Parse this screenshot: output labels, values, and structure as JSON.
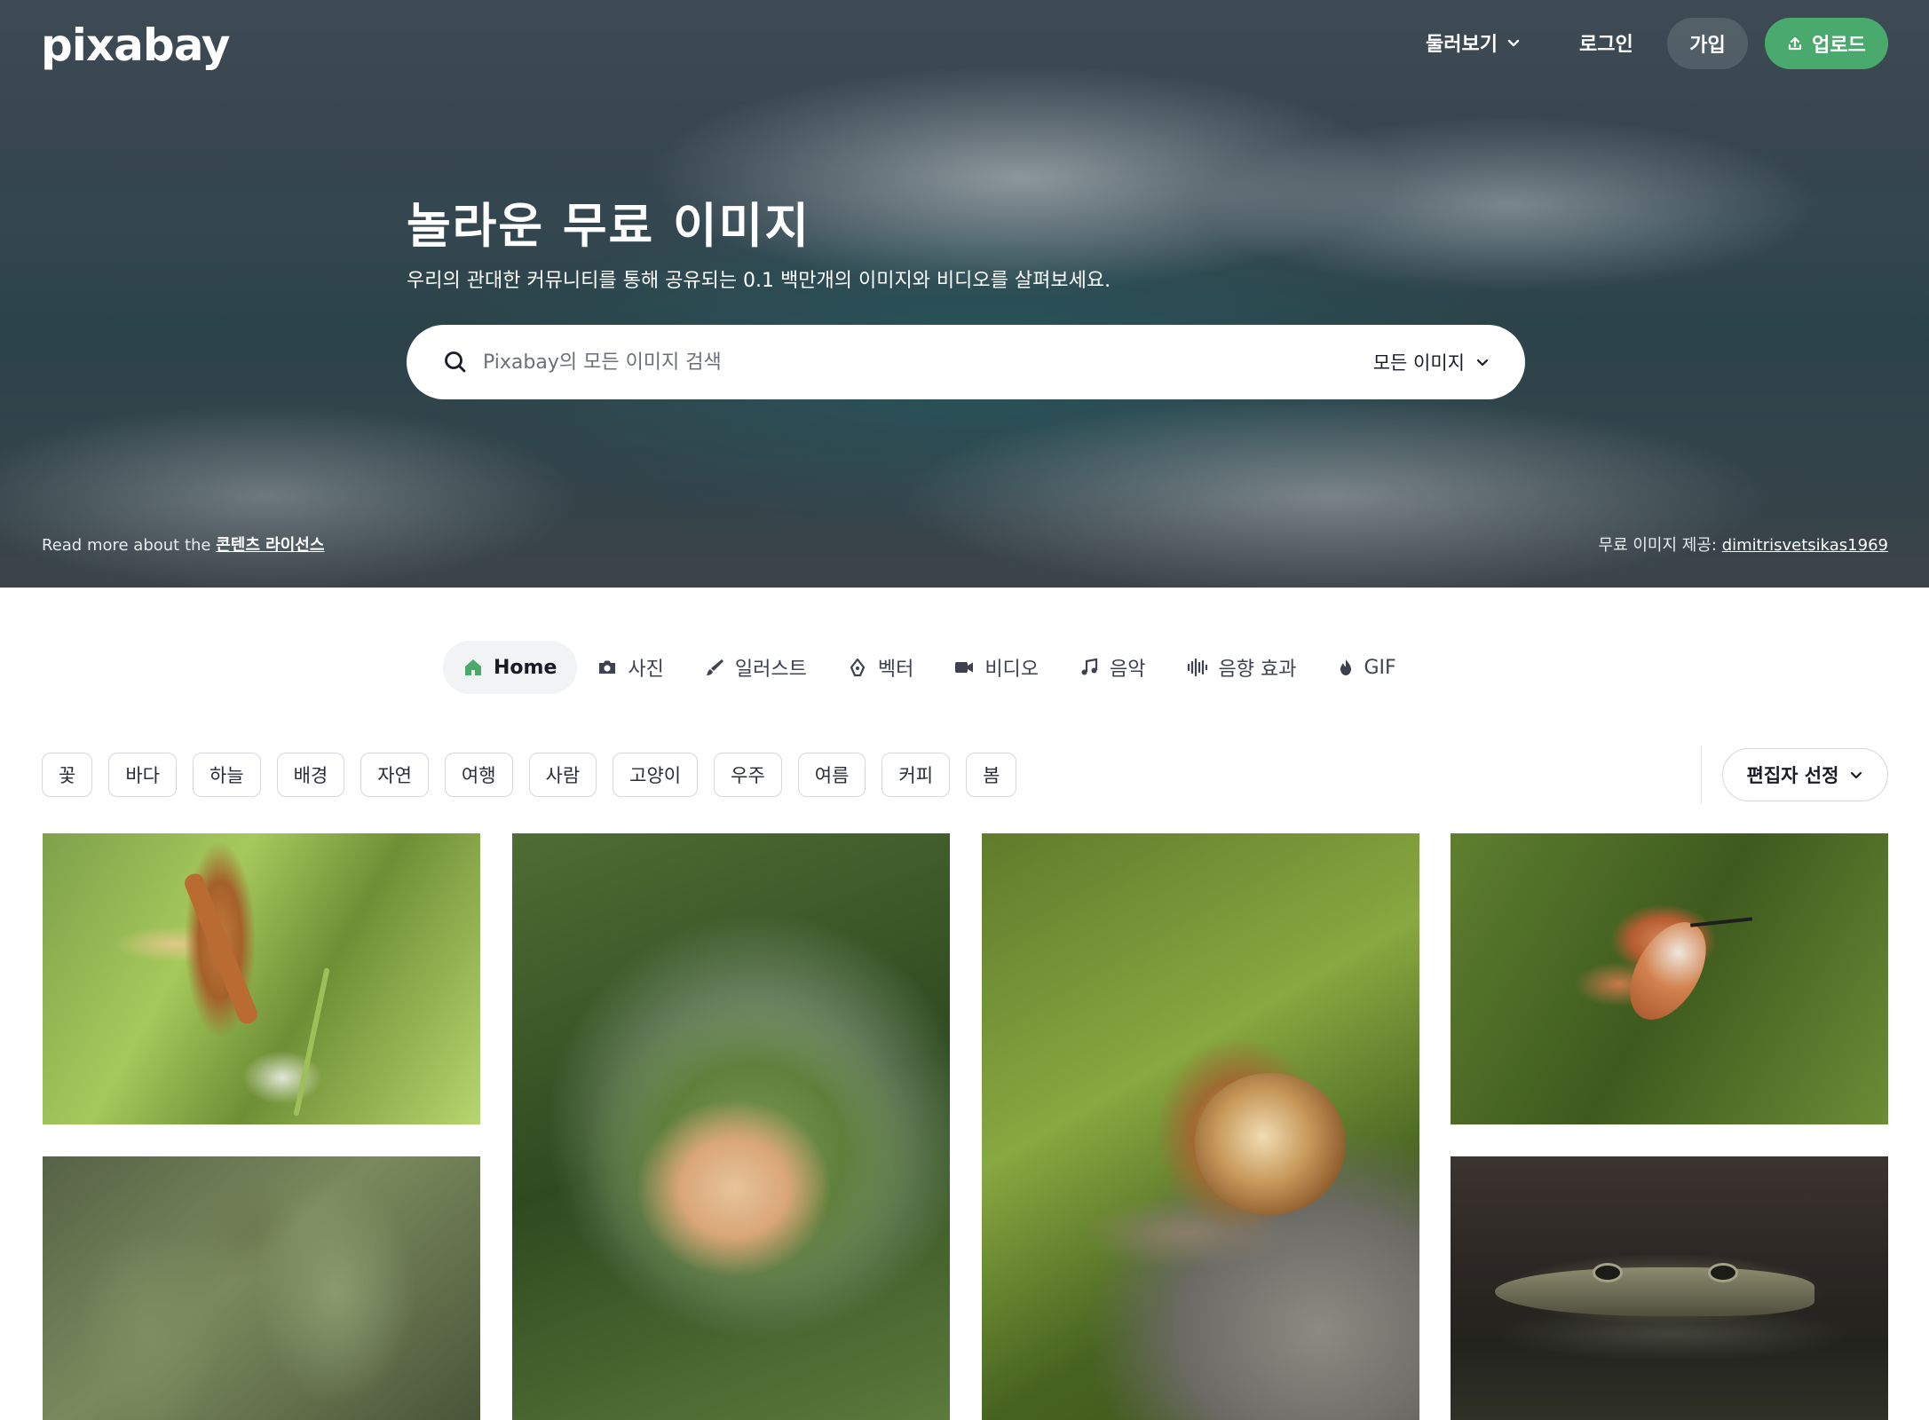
{
  "header": {
    "logo": "pixabay",
    "nav": {
      "browse": "둘러보기",
      "login": "로그인",
      "join": "가입",
      "upload": "업로드"
    }
  },
  "hero": {
    "title": "놀라운 무료 이미지",
    "subtitle": "우리의 관대한 커뮤니티를 통해 공유되는 0.1 백만개의 이미지와 비디오를 살펴보세요.",
    "search": {
      "placeholder": "Pixabay의 모든 이미지 검색",
      "value": "",
      "type_selected": "모든 이미지"
    },
    "license_prefix": "Read more about the",
    "license_link": "콘텐츠 라이선스",
    "credit_prefix": "무료 이미지 제공:",
    "credit_user": "dimitrisvetsikas1969"
  },
  "category_tabs": [
    {
      "label": "Home",
      "icon": "home-icon",
      "active": true
    },
    {
      "label": "사진",
      "icon": "camera-icon",
      "active": false
    },
    {
      "label": "일러스트",
      "icon": "brush-icon",
      "active": false
    },
    {
      "label": "벡터",
      "icon": "pen-nib-icon",
      "active": false
    },
    {
      "label": "비디오",
      "icon": "video-icon",
      "active": false
    },
    {
      "label": "음악",
      "icon": "music-note-icon",
      "active": false
    },
    {
      "label": "음향 효과",
      "icon": "sound-wave-icon",
      "active": false
    },
    {
      "label": "GIF",
      "icon": "flame-icon",
      "active": false
    }
  ],
  "chips": [
    "꽃",
    "바다",
    "하늘",
    "배경",
    "자연",
    "여행",
    "사람",
    "고양이",
    "우주",
    "여름",
    "커피",
    "봄"
  ],
  "sort": {
    "selected": "편집자 선정"
  },
  "colors": {
    "brand_green": "#4aa96c",
    "home_icon_green": "#4aa96c",
    "text_dark": "#191b26",
    "chip_border": "#d5d7dc"
  },
  "gallery": [
    {
      "subject": "insect-on-plant"
    },
    {
      "subject": "poppy-bud"
    },
    {
      "subject": "snail-on-rock"
    },
    {
      "subject": "hummingbird"
    },
    {
      "subject": "succulent-leaves"
    },
    {
      "subject": "crocodile-in-water"
    }
  ]
}
